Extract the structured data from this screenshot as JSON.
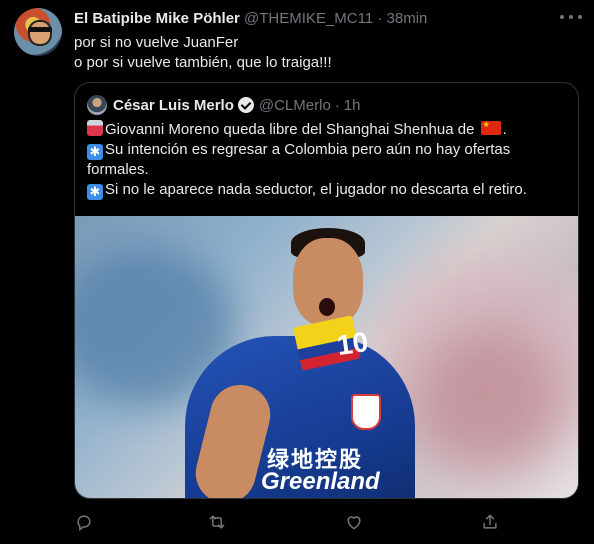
{
  "tweet": {
    "display_name": "El Batipibe Mike Pöhler",
    "handle": "@THEMIKE_MC11",
    "separator": "·",
    "time": "38min",
    "text_lines": [
      "por si no vuelve JuanFer",
      "o por si vuelve también, que lo traiga!!!"
    ]
  },
  "quoted": {
    "display_name": "César Luis Merlo",
    "handle": "@CLMerlo",
    "separator": "·",
    "time": "1h",
    "lines": [
      "Giovanni Moreno queda libre del Shanghai Shenhua de ",
      "Su intención es regresar a Colombia pero aún no hay ofertas",
      "formales.",
      "Si no le aparece nada seductor, el jugador no descarta el retiro."
    ],
    "photo": {
      "shirt_number": "10",
      "shirt_text_zh": "绿地控股",
      "shirt_text_en": "Greenland"
    }
  },
  "icons": {
    "reply": "reply-icon",
    "retweet": "retweet-icon",
    "like": "like-icon",
    "share": "share-icon",
    "more": "more-icon",
    "verified": "verified-badge-icon"
  }
}
